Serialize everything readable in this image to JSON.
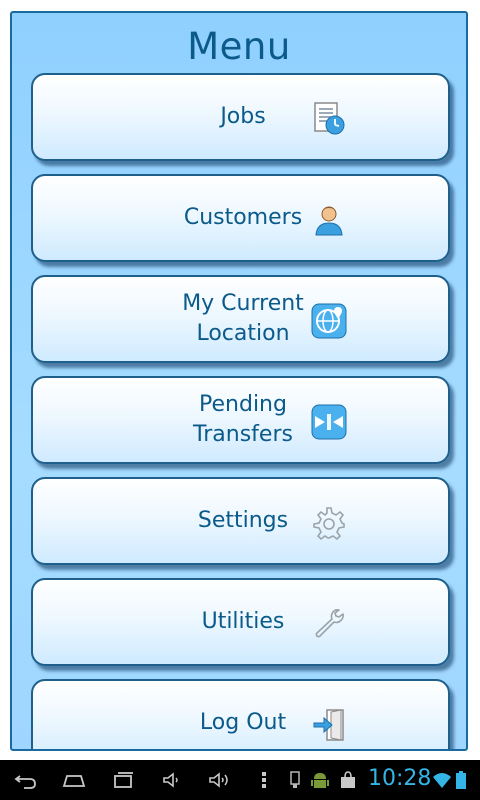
{
  "menu": {
    "title": "Menu",
    "items": [
      {
        "label": "Jobs",
        "icon": "jobs-icon"
      },
      {
        "label": "Customers",
        "icon": "customer-icon"
      },
      {
        "label": "My Current\nLocation",
        "icon": "location-globe-icon"
      },
      {
        "label": "Pending\nTransfers",
        "icon": "transfers-icon"
      },
      {
        "label": "Settings",
        "icon": "gear-icon"
      },
      {
        "label": "Utilities",
        "icon": "wrench-icon"
      },
      {
        "label": "Log Out",
        "icon": "logout-door-icon"
      }
    ]
  },
  "system_bar": {
    "time": "10:28",
    "buttons": [
      "back-icon",
      "home-icon",
      "recent-apps-icon",
      "volume-down-icon",
      "volume-up-icon",
      "menu-icon"
    ],
    "status_icons": [
      "usb-icon",
      "android-debug-icon",
      "shopping-bag-icon",
      "wifi-icon",
      "battery-icon"
    ],
    "accent_color": "#35b5e5"
  },
  "colors": {
    "panel": "#9fd6ff",
    "text": "#0b5a8a",
    "border": "#1e5f8c"
  }
}
